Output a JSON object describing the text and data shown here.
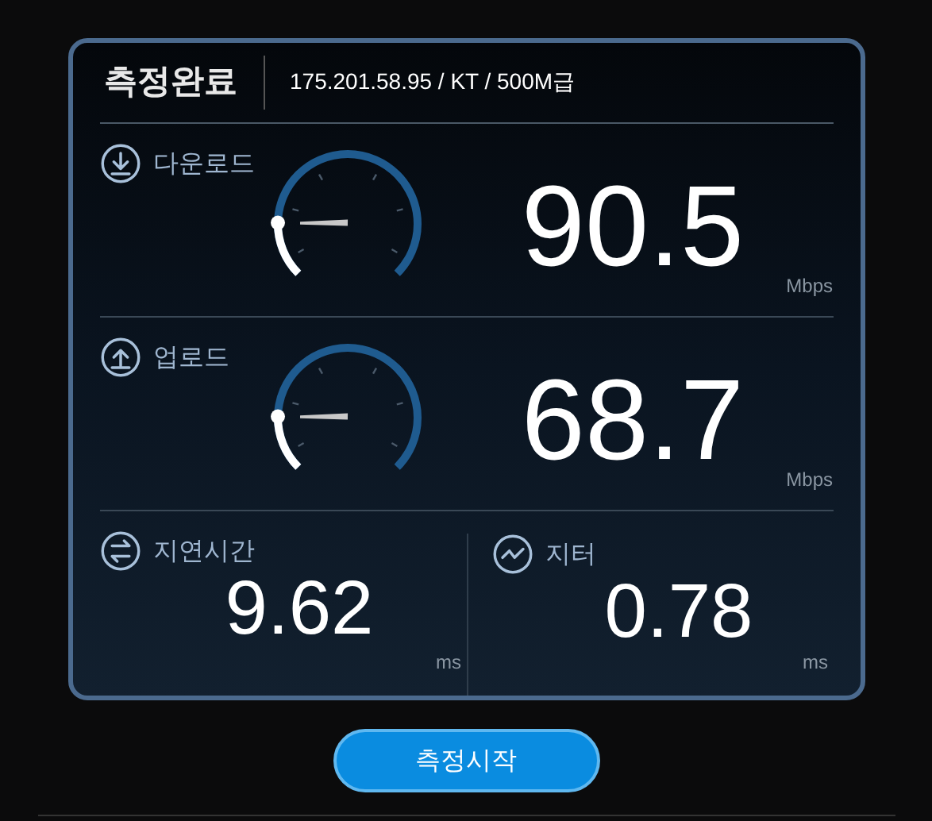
{
  "header": {
    "status": "측정완료",
    "connection": "175.201.58.95 / KT / 500M급"
  },
  "speeds": [
    {
      "kind": "download",
      "label": "다운로드",
      "value": "90.5",
      "unit": "Mbps"
    },
    {
      "kind": "upload",
      "label": "업로드",
      "value": "68.7",
      "unit": "Mbps"
    }
  ],
  "metrics": [
    {
      "kind": "latency",
      "label": "지연시간",
      "value": "9.62",
      "unit": "ms"
    },
    {
      "kind": "jitter",
      "label": "지터",
      "value": "0.78",
      "unit": "ms"
    }
  ],
  "start_button": "측정시작"
}
